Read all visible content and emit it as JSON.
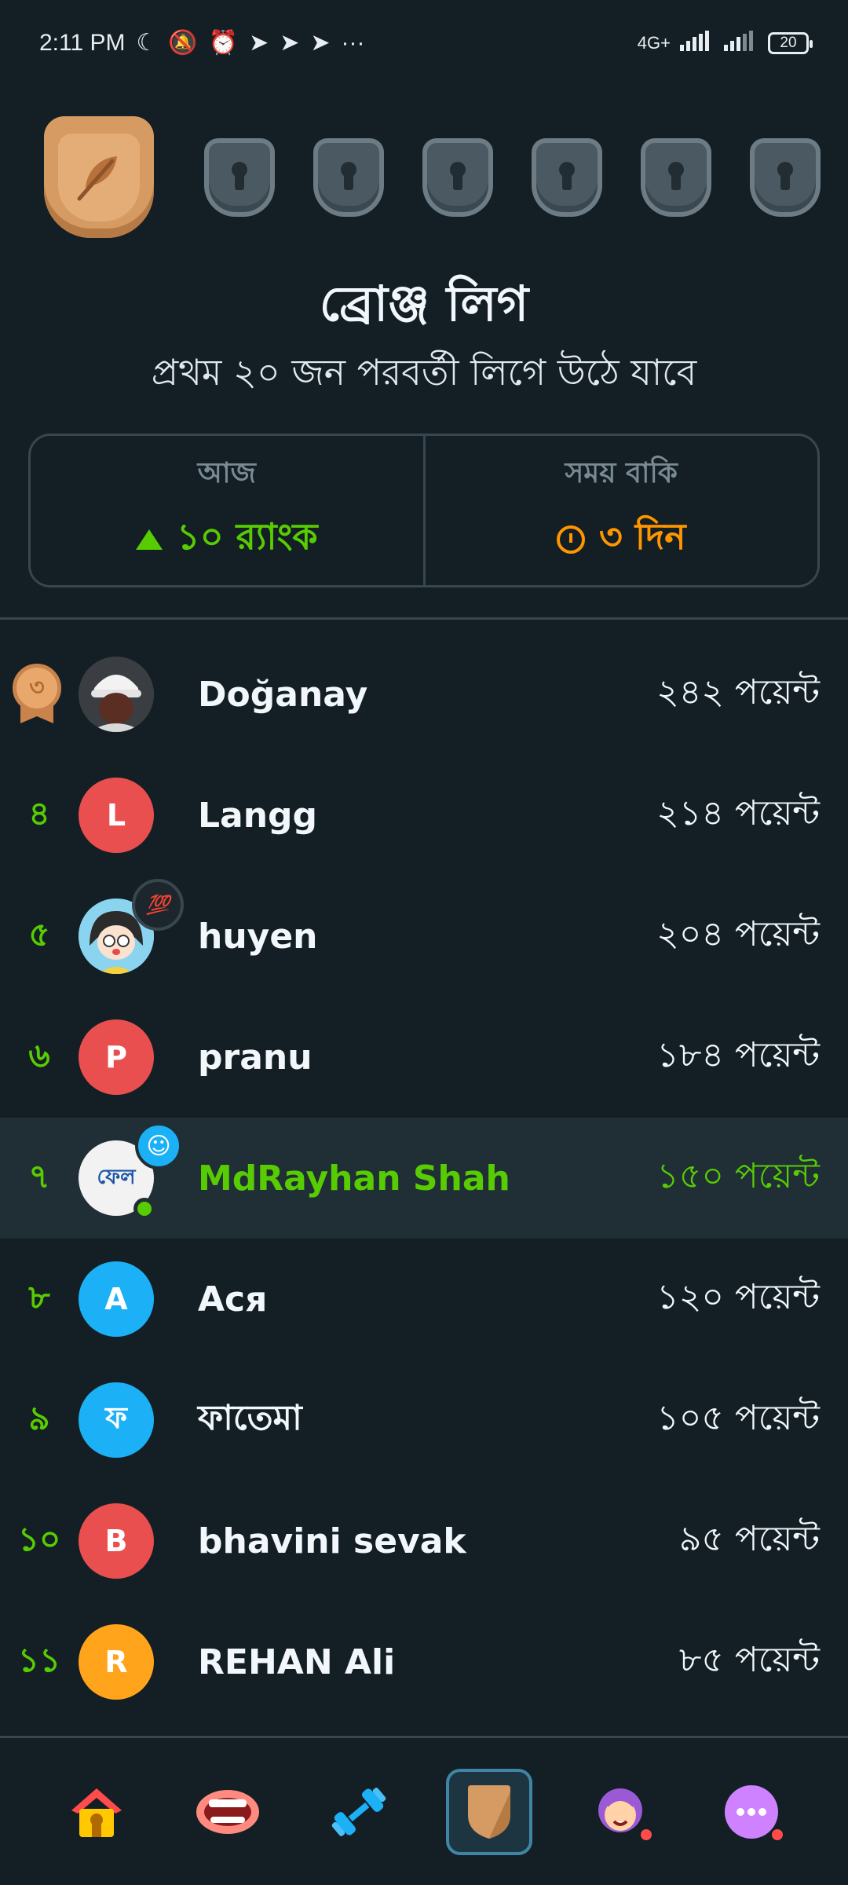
{
  "status_bar": {
    "time": "2:11 PM",
    "network": "4G+",
    "battery": "20"
  },
  "league": {
    "title": "ব্রোঞ্জ লিগ",
    "subtitle": "প্রথম ২০ জন পরবর্তী লিগে উঠে যাবে"
  },
  "stats": {
    "today_label": "আজ",
    "today_value": "১০ র‍্যাংক",
    "time_left_label": "সময় বাকি",
    "time_left_value": "৩ দিন"
  },
  "leaderboard": [
    {
      "rank": "৩",
      "name": "Doğanay",
      "points": "২৪২ পয়েন্ট"
    },
    {
      "rank": "৪",
      "name": "Langg",
      "initial": "L",
      "avatar_color": "#ea4f4f",
      "points": "২১৪ পয়েন্ট"
    },
    {
      "rank": "৫",
      "name": "huyen",
      "points": "২০৪ পয়েন্ট",
      "badge": "💯"
    },
    {
      "rank": "৬",
      "name": "pranu",
      "initial": "P",
      "avatar_color": "#ea4f4f",
      "points": "১৮৪ পয়েন্ট"
    },
    {
      "rank": "৭",
      "name": "MdRayhan Shah",
      "avatar_text": "ফেল",
      "points": "১৫০ পয়েন্ট"
    },
    {
      "rank": "৮",
      "name": "Ася",
      "initial": "A",
      "avatar_color": "#1cb0f6",
      "points": "১২০ পয়েন্ট"
    },
    {
      "rank": "৯",
      "name": "ফাতেমা",
      "initial": "ফ",
      "avatar_color": "#1cb0f6",
      "points": "১০৫ পয়েন্ট"
    },
    {
      "rank": "১০",
      "name": "bhavini sevak",
      "initial": "B",
      "avatar_color": "#ea4f4f",
      "points": "৯৫ পয়েন্ট"
    },
    {
      "rank": "১১",
      "name": "REHAN Ali",
      "initial": "R",
      "avatar_color": "#ffa41b",
      "points": "৮৫ পয়েন্ট"
    }
  ],
  "tabs": [
    "home-icon",
    "speaking-icon",
    "practice-icon",
    "leagues-icon",
    "profile-icon",
    "more-icon"
  ]
}
